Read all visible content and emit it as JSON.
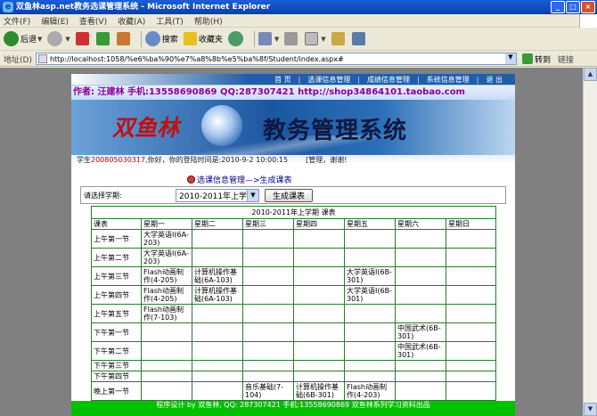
{
  "window": {
    "title": "双鱼林asp.net教务选课管理系统 - Microsoft Internet Explorer"
  },
  "menu": [
    "文件(F)",
    "编辑(E)",
    "查看(V)",
    "收藏(A)",
    "工具(T)",
    "帮助(H)"
  ],
  "toolbar": {
    "back": "后退",
    "search": "搜索",
    "favorites": "收藏夹"
  },
  "address": {
    "label": "地址(D)",
    "url": "http://localhost:1058/%e6%ba%90%e7%a8%8b%e5%ba%8f/Student/index.aspx#",
    "go": "转到",
    "links": "链接"
  },
  "nav": [
    "首 页",
    "选课信息管理",
    "成绩信息管理",
    "系统信息管理",
    "退 出"
  ],
  "author_line": "作者: 汪建林  手机:13558690869 QQ:287307421 http://shop34864101.taobao.com",
  "banner": {
    "brand": "双鱼林",
    "system": "教务管理系统"
  },
  "welcome": {
    "prefix": "学生",
    "id": "200805030317",
    "text": ",你好，你的登陆时间是:2010-9-2 10:00:15",
    "tip": "[管理，谢谢!"
  },
  "breadcrumb": "选课信息管理—>生成课表",
  "semester": {
    "label": "请选择学期:",
    "value": "2010-2011年上学期",
    "button": "生成课表"
  },
  "schedule": {
    "caption": "2010-2011年上学期 课表",
    "headers": [
      "课表",
      "星期一",
      "星期二",
      "星期三",
      "星期四",
      "星期五",
      "星期六",
      "星期日"
    ],
    "rows": [
      [
        "上午第一节",
        "大学英语I(6A-203)",
        "",
        "",
        "",
        "",
        "",
        ""
      ],
      [
        "上午第二节",
        "大学英语I(6A-203)",
        "",
        "",
        "",
        "",
        "",
        ""
      ],
      [
        "上午第三节",
        "Flash动画制作(4-205)",
        "计算机操作基础(6A-103)",
        "",
        "",
        "大学英语I(6B-301)",
        "",
        ""
      ],
      [
        "上午第四节",
        "Flash动画制作(4-205)",
        "计算机操作基础(6A-103)",
        "",
        "",
        "大学英语I(6B-301)",
        "",
        ""
      ],
      [
        "上午第五节",
        "Flash动画制作(7-103)",
        "",
        "",
        "",
        "",
        "",
        ""
      ],
      [
        "下午第一节",
        "",
        "",
        "",
        "",
        "",
        "中国武术(6B-301)",
        ""
      ],
      [
        "下午第二节",
        "",
        "",
        "",
        "",
        "",
        "中国武术(6B-301)",
        ""
      ],
      [
        "下午第三节",
        "",
        "",
        "",
        "",
        "",
        "",
        ""
      ],
      [
        "下午第四节",
        "",
        "",
        "",
        "",
        "",
        "",
        ""
      ],
      [
        "晚上第一节",
        "",
        "",
        "音乐基础(7-104)",
        "计算机操作基础(6B-301)",
        "Flash动画制作(4-203)",
        "",
        ""
      ]
    ]
  },
  "footer": "程序设计 by 双鱼林, QQ: 287307421 手机:13558690869 双鱼林系列学习资料出品"
}
